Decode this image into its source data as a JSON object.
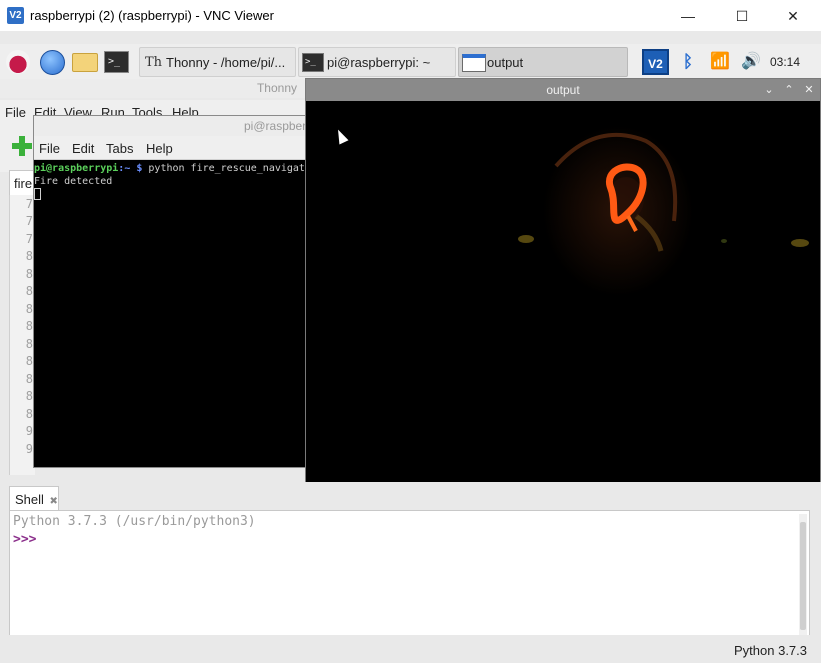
{
  "vnc": {
    "logo": "V2",
    "title": "raspberrypi (2) (raspberrypi) - VNC Viewer",
    "minimize_glyph": "—",
    "maximize_glyph": "☐",
    "close_glyph": "✕"
  },
  "taskbar": {
    "icons": [
      "raspberry-pi-menu-icon",
      "globe-icon",
      "folder-icon",
      "terminal-icon"
    ],
    "term_icon_glyph": ">_",
    "tasks": [
      {
        "label": "Thonny  -  /home/pi/...",
        "icon": "Th"
      },
      {
        "label": "pi@raspberrypi: ~",
        "icon": ">_"
      },
      {
        "label": "output"
      }
    ],
    "tray": {
      "vnc_label": "V2",
      "bluetooth_glyph": "ᛒ",
      "wifi_glyph": "📶",
      "volume_glyph": "🔊",
      "clock": "03:14"
    }
  },
  "thonny": {
    "title": "Thonny",
    "menu": [
      "File",
      "Edit",
      "View",
      "Run",
      "Tools",
      "Help"
    ],
    "editor_tab": "fire",
    "line_numbers": [
      "7",
      "7",
      "7",
      "8",
      "8",
      "8",
      "8",
      "8",
      "8",
      "8",
      "8",
      "8",
      "8",
      "9",
      "9"
    ]
  },
  "terminal": {
    "title": "pi@raspberrypi: ~",
    "menu": [
      "File",
      "Edit",
      "Tabs",
      "Help"
    ],
    "prompt_user": "pi@raspberrypi",
    "prompt_path": ":~ $",
    "command": " python fire_rescue_navigation.py",
    "output_line": "Fire detected"
  },
  "output_window": {
    "title": "output",
    "controls": [
      "⌄",
      "⌃",
      "✕"
    ]
  },
  "shell": {
    "tab_label": "Shell",
    "tab_close": "✖",
    "banner": "Python 3.7.3 (/usr/bin/python3)",
    "prompt": ">>>"
  },
  "status": {
    "interpreter": "Python 3.7.3"
  },
  "colors": {
    "fire_ring": "#ff5a14",
    "prompt_green": "#5bd05b",
    "prompt_blue": "#6c8fff",
    "shell_prompt": "#8b2f8b"
  }
}
